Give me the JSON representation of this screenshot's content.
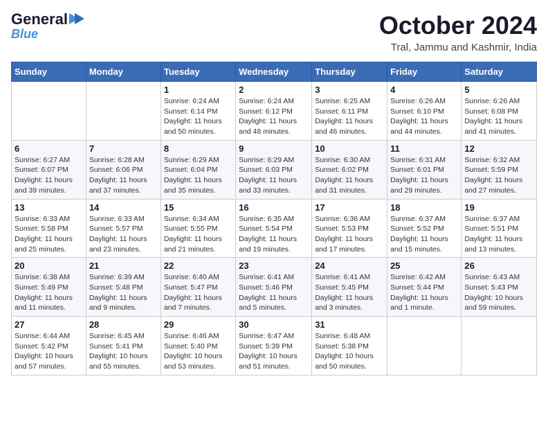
{
  "logo": {
    "line1": "General",
    "line2": "Blue"
  },
  "header": {
    "title": "October 2024",
    "subtitle": "Tral, Jammu and Kashmir, India"
  },
  "columns": [
    "Sunday",
    "Monday",
    "Tuesday",
    "Wednesday",
    "Thursday",
    "Friday",
    "Saturday"
  ],
  "weeks": [
    [
      {
        "day": "",
        "info": ""
      },
      {
        "day": "",
        "info": ""
      },
      {
        "day": "1",
        "info": "Sunrise: 6:24 AM\nSunset: 6:14 PM\nDaylight: 11 hours and 50 minutes."
      },
      {
        "day": "2",
        "info": "Sunrise: 6:24 AM\nSunset: 6:12 PM\nDaylight: 11 hours and 48 minutes."
      },
      {
        "day": "3",
        "info": "Sunrise: 6:25 AM\nSunset: 6:11 PM\nDaylight: 11 hours and 46 minutes."
      },
      {
        "day": "4",
        "info": "Sunrise: 6:26 AM\nSunset: 6:10 PM\nDaylight: 11 hours and 44 minutes."
      },
      {
        "day": "5",
        "info": "Sunrise: 6:26 AM\nSunset: 6:08 PM\nDaylight: 11 hours and 41 minutes."
      }
    ],
    [
      {
        "day": "6",
        "info": "Sunrise: 6:27 AM\nSunset: 6:07 PM\nDaylight: 11 hours and 39 minutes."
      },
      {
        "day": "7",
        "info": "Sunrise: 6:28 AM\nSunset: 6:06 PM\nDaylight: 11 hours and 37 minutes."
      },
      {
        "day": "8",
        "info": "Sunrise: 6:29 AM\nSunset: 6:04 PM\nDaylight: 11 hours and 35 minutes."
      },
      {
        "day": "9",
        "info": "Sunrise: 6:29 AM\nSunset: 6:03 PM\nDaylight: 11 hours and 33 minutes."
      },
      {
        "day": "10",
        "info": "Sunrise: 6:30 AM\nSunset: 6:02 PM\nDaylight: 11 hours and 31 minutes."
      },
      {
        "day": "11",
        "info": "Sunrise: 6:31 AM\nSunset: 6:01 PM\nDaylight: 11 hours and 29 minutes."
      },
      {
        "day": "12",
        "info": "Sunrise: 6:32 AM\nSunset: 5:59 PM\nDaylight: 11 hours and 27 minutes."
      }
    ],
    [
      {
        "day": "13",
        "info": "Sunrise: 6:33 AM\nSunset: 5:58 PM\nDaylight: 11 hours and 25 minutes."
      },
      {
        "day": "14",
        "info": "Sunrise: 6:33 AM\nSunset: 5:57 PM\nDaylight: 11 hours and 23 minutes."
      },
      {
        "day": "15",
        "info": "Sunrise: 6:34 AM\nSunset: 5:55 PM\nDaylight: 11 hours and 21 minutes."
      },
      {
        "day": "16",
        "info": "Sunrise: 6:35 AM\nSunset: 5:54 PM\nDaylight: 11 hours and 19 minutes."
      },
      {
        "day": "17",
        "info": "Sunrise: 6:36 AM\nSunset: 5:53 PM\nDaylight: 11 hours and 17 minutes."
      },
      {
        "day": "18",
        "info": "Sunrise: 6:37 AM\nSunset: 5:52 PM\nDaylight: 11 hours and 15 minutes."
      },
      {
        "day": "19",
        "info": "Sunrise: 6:37 AM\nSunset: 5:51 PM\nDaylight: 11 hours and 13 minutes."
      }
    ],
    [
      {
        "day": "20",
        "info": "Sunrise: 6:38 AM\nSunset: 5:49 PM\nDaylight: 11 hours and 11 minutes."
      },
      {
        "day": "21",
        "info": "Sunrise: 6:39 AM\nSunset: 5:48 PM\nDaylight: 11 hours and 9 minutes."
      },
      {
        "day": "22",
        "info": "Sunrise: 6:40 AM\nSunset: 5:47 PM\nDaylight: 11 hours and 7 minutes."
      },
      {
        "day": "23",
        "info": "Sunrise: 6:41 AM\nSunset: 5:46 PM\nDaylight: 11 hours and 5 minutes."
      },
      {
        "day": "24",
        "info": "Sunrise: 6:41 AM\nSunset: 5:45 PM\nDaylight: 11 hours and 3 minutes."
      },
      {
        "day": "25",
        "info": "Sunrise: 6:42 AM\nSunset: 5:44 PM\nDaylight: 11 hours and 1 minute."
      },
      {
        "day": "26",
        "info": "Sunrise: 6:43 AM\nSunset: 5:43 PM\nDaylight: 10 hours and 59 minutes."
      }
    ],
    [
      {
        "day": "27",
        "info": "Sunrise: 6:44 AM\nSunset: 5:42 PM\nDaylight: 10 hours and 57 minutes."
      },
      {
        "day": "28",
        "info": "Sunrise: 6:45 AM\nSunset: 5:41 PM\nDaylight: 10 hours and 55 minutes."
      },
      {
        "day": "29",
        "info": "Sunrise: 6:46 AM\nSunset: 5:40 PM\nDaylight: 10 hours and 53 minutes."
      },
      {
        "day": "30",
        "info": "Sunrise: 6:47 AM\nSunset: 5:39 PM\nDaylight: 10 hours and 51 minutes."
      },
      {
        "day": "31",
        "info": "Sunrise: 6:48 AM\nSunset: 5:38 PM\nDaylight: 10 hours and 50 minutes."
      },
      {
        "day": "",
        "info": ""
      },
      {
        "day": "",
        "info": ""
      }
    ]
  ]
}
